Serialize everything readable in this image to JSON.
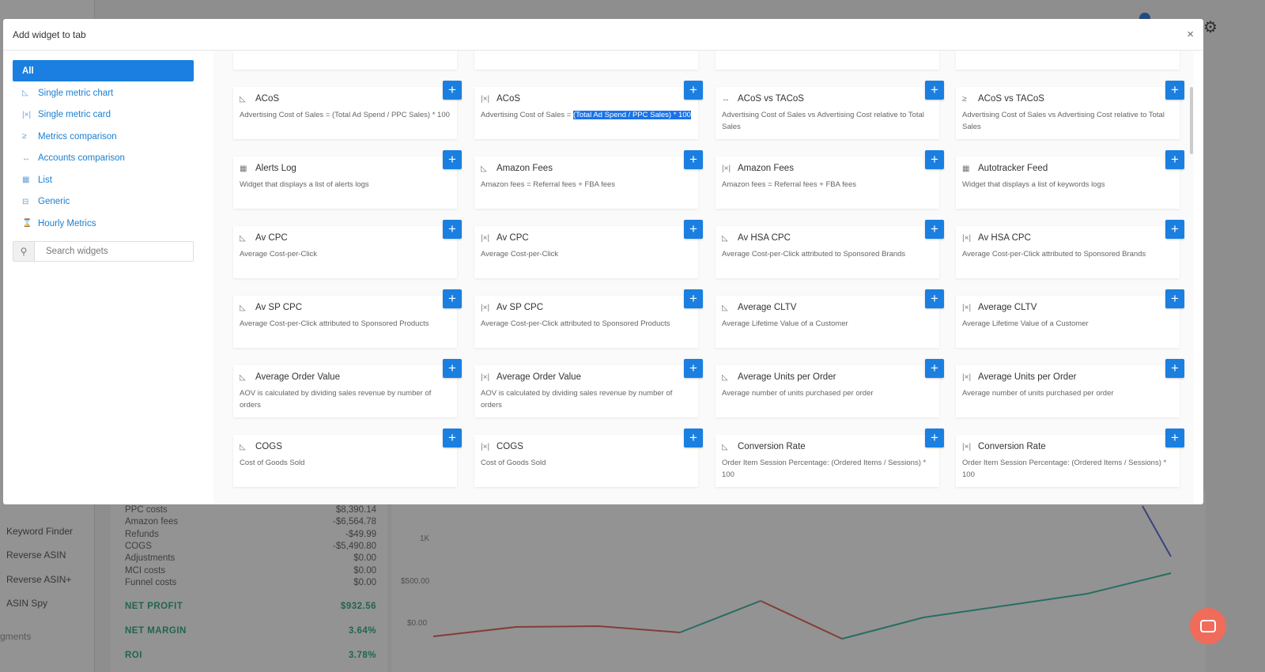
{
  "background": {
    "sidebar": [
      "Keyword Finder",
      "Reverse ASIN",
      "Reverse ASIN+",
      "ASIN Spy",
      "gments"
    ],
    "pnl": [
      {
        "label": "PPC costs",
        "value": "$8,390.14"
      },
      {
        "label": "Amazon fees",
        "value": "-$6,564.78"
      },
      {
        "label": "Refunds",
        "value": "-$49.99"
      },
      {
        "label": "COGS",
        "value": "-$5,490.80"
      },
      {
        "label": "Adjustments",
        "value": "$0.00"
      },
      {
        "label": "MCI costs",
        "value": "$0.00"
      },
      {
        "label": "Funnel costs",
        "value": "$0.00"
      }
    ],
    "net_profit": {
      "label": "NET PROFIT",
      "value": "$932.56"
    },
    "net_margin": {
      "label": "NET MARGIN",
      "value": "3.64%"
    },
    "roi": {
      "label": "ROI",
      "value": "3.78%"
    },
    "chart_y_ticks": [
      "1K",
      "$500.00",
      "$0.00"
    ],
    "colors": {
      "line_a": "#e0524a",
      "line_b": "#2ab39a",
      "line_c": "#4a5fd0"
    }
  },
  "modal": {
    "title": "Add widget to tab",
    "close": "×",
    "categories": [
      {
        "label": "All",
        "icon": ""
      },
      {
        "label": "Single metric chart",
        "icon": "chart-icon"
      },
      {
        "label": "Single metric card",
        "icon": "card-icon"
      },
      {
        "label": "Metrics comparison",
        "icon": "greater-equal-icon"
      },
      {
        "label": "Accounts comparison",
        "icon": "arrows-icon"
      },
      {
        "label": "List",
        "icon": "table-icon"
      },
      {
        "label": "Generic",
        "icon": "generic-icon"
      },
      {
        "label": "Hourly Metrics",
        "icon": "hourglass-icon"
      }
    ],
    "search_placeholder": "Search widgets",
    "add_label": "+",
    "accent": "#1a7fe0",
    "widgets": [
      {
        "title": "ACoS",
        "icon": "chart-icon",
        "desc": "Advertising Cost of Sales = (Total Ad Spend / PPC Sales) * 100"
      },
      {
        "title": "ACoS",
        "icon": "card-icon",
        "desc": "Advertising Cost of Sales = ",
        "desc_selected": "(Total Ad Spend / PPC Sales) * 100"
      },
      {
        "title": "ACoS vs TACoS",
        "icon": "arrows-icon",
        "desc": "Advertising Cost of Sales vs Advertising Cost relative to Total Sales"
      },
      {
        "title": "ACoS vs TACoS",
        "icon": "greater-equal-icon",
        "desc": "Advertising Cost of Sales vs Advertising Cost relative to Total Sales"
      },
      {
        "title": "Alerts Log",
        "icon": "table-icon",
        "desc": "Widget that displays a list of alerts logs"
      },
      {
        "title": "Amazon Fees",
        "icon": "chart-icon",
        "desc": "Amazon fees = Referral fees + FBA fees"
      },
      {
        "title": "Amazon Fees",
        "icon": "card-icon",
        "desc": "Amazon fees = Referral fees + FBA fees"
      },
      {
        "title": "Autotracker Feed",
        "icon": "table-icon",
        "desc": "Widget that displays a list of keywords logs"
      },
      {
        "title": "Av CPC",
        "icon": "chart-icon",
        "desc": "Average Cost-per-Click"
      },
      {
        "title": "Av CPC",
        "icon": "card-icon",
        "desc": "Average Cost-per-Click"
      },
      {
        "title": "Av HSA CPC",
        "icon": "chart-icon",
        "desc": "Average Cost-per-Click attributed to Sponsored Brands"
      },
      {
        "title": "Av HSA CPC",
        "icon": "card-icon",
        "desc": "Average Cost-per-Click attributed to Sponsored Brands"
      },
      {
        "title": "Av SP CPC",
        "icon": "chart-icon",
        "desc": "Average Cost-per-Click attributed to Sponsored Products"
      },
      {
        "title": "Av SP CPC",
        "icon": "card-icon",
        "desc": "Average Cost-per-Click attributed to Sponsored Products"
      },
      {
        "title": "Average CLTV",
        "icon": "chart-icon",
        "desc": "Average Lifetime Value of a Customer"
      },
      {
        "title": "Average CLTV",
        "icon": "card-icon",
        "desc": "Average Lifetime Value of a Customer"
      },
      {
        "title": "Average Order Value",
        "icon": "chart-icon",
        "desc": "AOV is calculated by dividing sales revenue by number of orders"
      },
      {
        "title": "Average Order Value",
        "icon": "card-icon",
        "desc": "AOV is calculated by dividing sales revenue by number of orders"
      },
      {
        "title": "Average Units per Order",
        "icon": "chart-icon",
        "desc": "Average number of units purchased per order"
      },
      {
        "title": "Average Units per Order",
        "icon": "card-icon",
        "desc": "Average number of units purchased per order"
      },
      {
        "title": "COGS",
        "icon": "chart-icon",
        "desc": "Cost of Goods Sold"
      },
      {
        "title": "COGS",
        "icon": "card-icon",
        "desc": "Cost of Goods Sold"
      },
      {
        "title": "Conversion Rate",
        "icon": "chart-icon",
        "desc": "Order Item Session Percentage: (Ordered Items / Sessions) * 100"
      },
      {
        "title": "Conversion Rate",
        "icon": "card-icon",
        "desc": "Order Item Session Percentage: (Ordered Items / Sessions) * 100"
      }
    ]
  }
}
